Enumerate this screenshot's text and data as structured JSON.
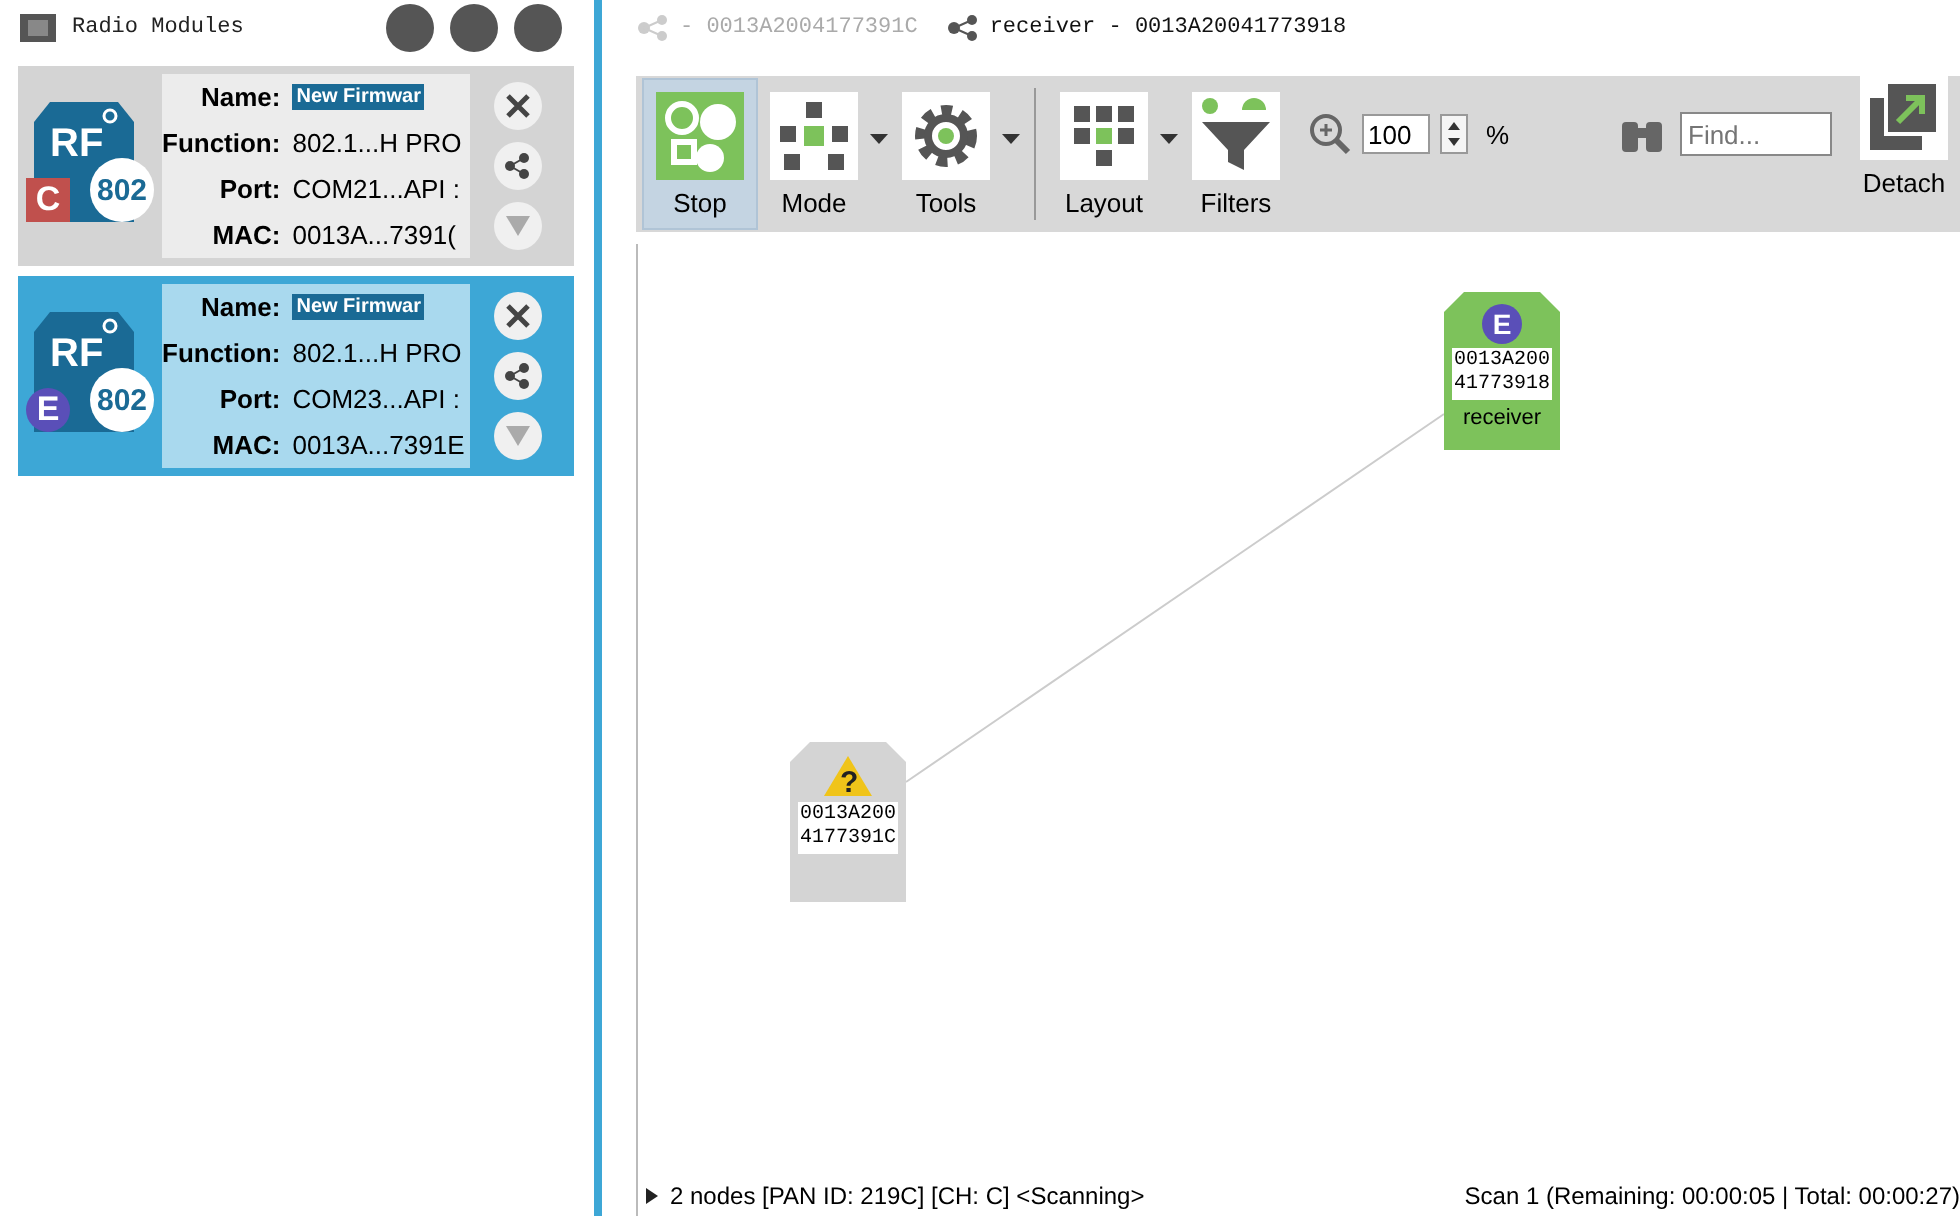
{
  "panel": {
    "title": "Radio Modules"
  },
  "modules": [
    {
      "badge": "C",
      "color": "#c0504d",
      "chip_label": "RF",
      "chip_text": "802",
      "selected": false,
      "name_label": "Name:",
      "name": "New Firmwar",
      "function_label": "Function:",
      "function": "802.1...H PRO",
      "port_label": "Port:",
      "port": "COM21...API :",
      "mac_label": "MAC:",
      "mac": "0013A...7391("
    },
    {
      "badge": "E",
      "color": "#5a4fb8",
      "chip_label": "RF",
      "chip_text": "802",
      "selected": true,
      "name_label": "Name:",
      "name": "New Firmwar",
      "function_label": "Function:",
      "function": "802.1...H PRO",
      "port_label": "Port:",
      "port": "COM23...API :",
      "mac_label": "MAC:",
      "mac": "0013A...7391E"
    }
  ],
  "tabs": [
    {
      "label": "- 0013A2004177391C",
      "selected": false
    },
    {
      "label": "receiver - 0013A20041773918",
      "selected": true
    }
  ],
  "toolbar": {
    "buttons": [
      {
        "kind": "stop",
        "label": "Stop",
        "selected": true,
        "dropdown": false
      },
      {
        "kind": "mode",
        "label": "Mode",
        "selected": false,
        "dropdown": true
      },
      {
        "kind": "tools",
        "label": "Tools",
        "selected": false,
        "dropdown": true
      },
      {
        "kind": "layout",
        "label": "Layout",
        "selected": false,
        "dropdown": true
      },
      {
        "kind": "filters",
        "label": "Filters",
        "selected": false,
        "dropdown": false
      }
    ],
    "zoom": "100",
    "zoom_unit": "%",
    "find": {
      "placeholder": "Find..."
    },
    "detach": "Detach"
  },
  "nodes": [
    {
      "kind": "known",
      "badge": "E",
      "address": [
        "0013A200",
        "41773918"
      ],
      "name": "receiver"
    },
    {
      "kind": "unknown",
      "badge": "?",
      "address": [
        "0013A200",
        "4177391C"
      ]
    }
  ],
  "status": {
    "left": "2 nodes [PAN ID: 219C] [CH: C] <Scanning>",
    "right": "Scan 1 (Remaining: 00:00:05 | Total: 00:00:27)"
  }
}
